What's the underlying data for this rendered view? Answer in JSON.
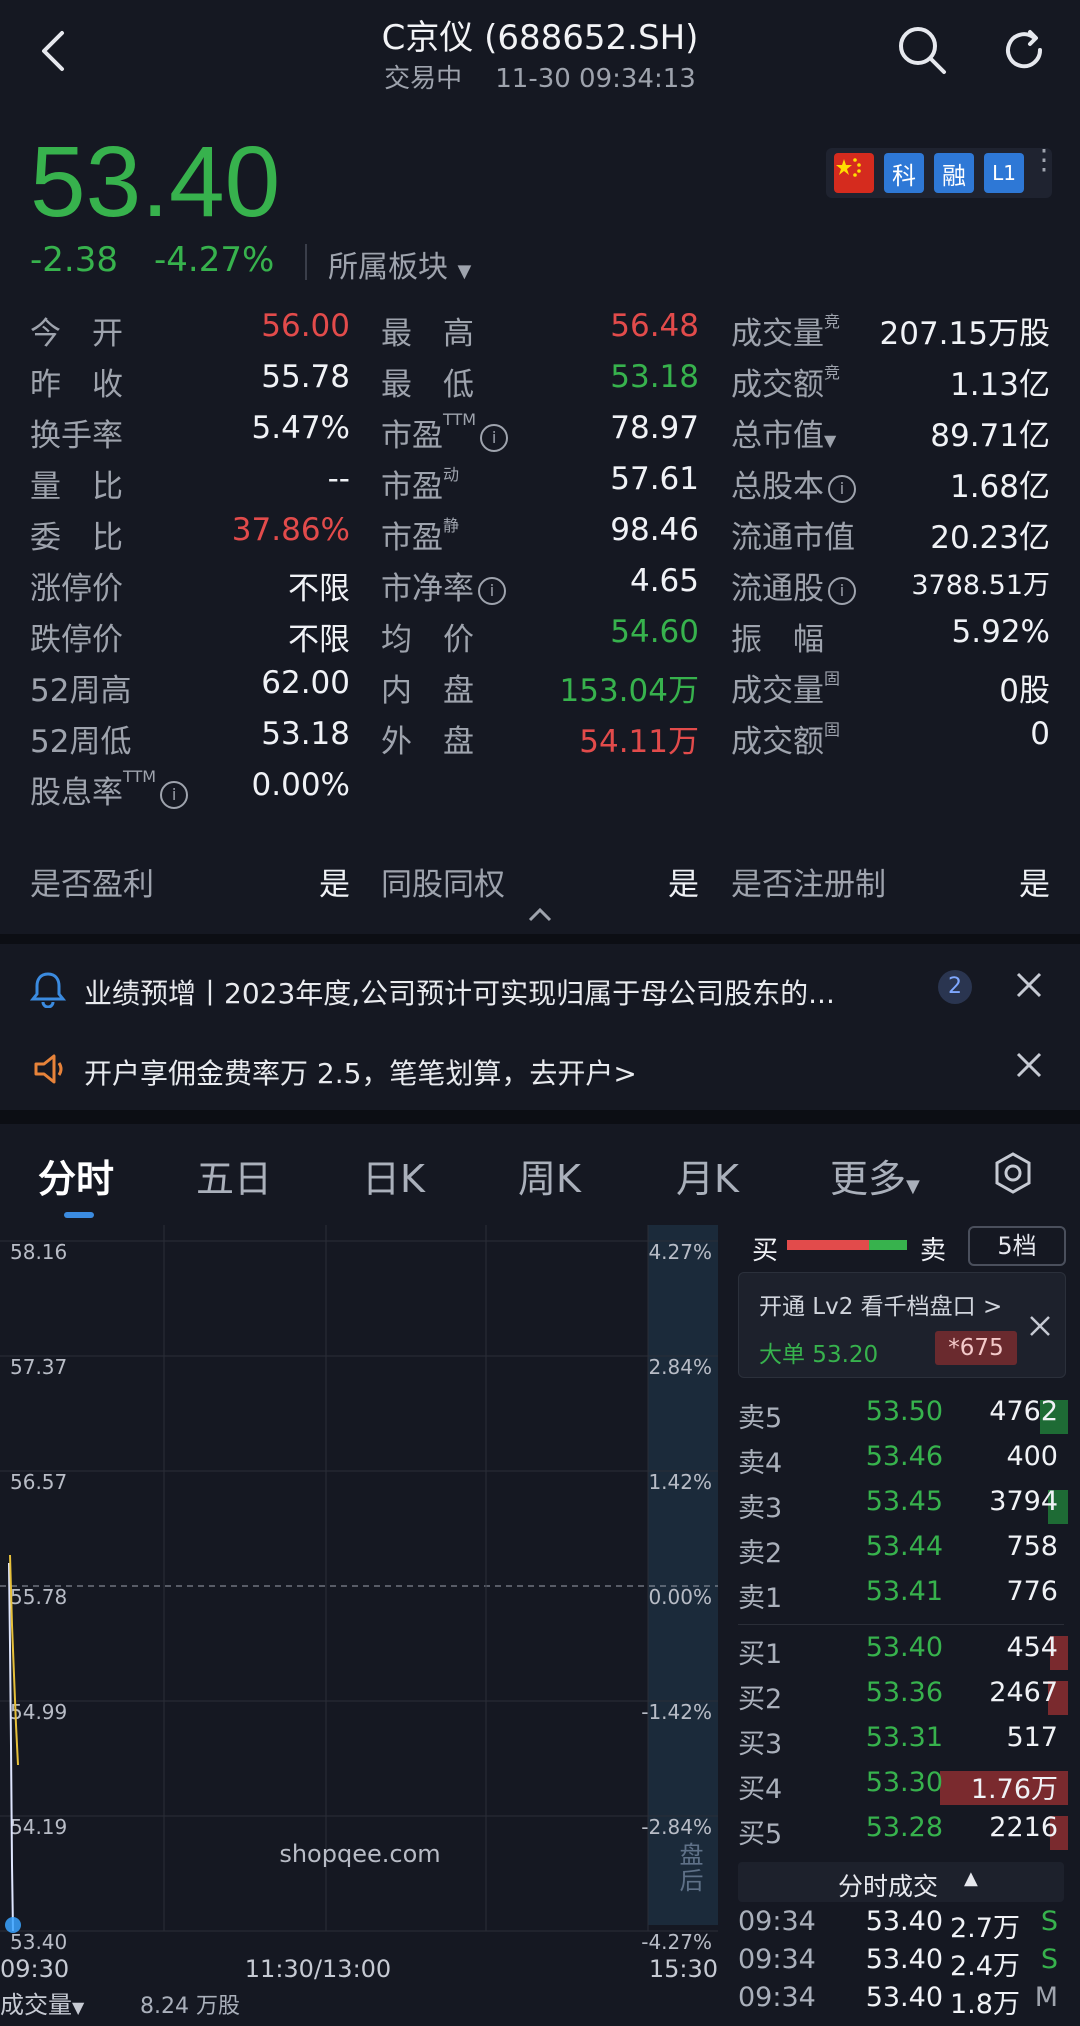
{
  "header": {
    "title": "C京仪 (688652.SH)",
    "status": "交易中",
    "datetime": "11-30 09:34:13"
  },
  "quote": {
    "price": "53.40",
    "change": "-2.38",
    "change_pct": "-4.27%",
    "sector": "所属板块",
    "badges": [
      "科",
      "融",
      "L1"
    ]
  },
  "stats": {
    "col1": [
      {
        "label": "今　开",
        "value": "56.00"
      },
      {
        "label": "昨　收",
        "value": "55.78"
      },
      {
        "label": "换手率",
        "value": "5.47%"
      },
      {
        "label": "量　比",
        "value": "--"
      },
      {
        "label": "委　比",
        "value": "37.86%"
      },
      {
        "label": "涨停价",
        "value": "不限"
      },
      {
        "label": "跌停价",
        "value": "不限"
      },
      {
        "label": "52周高",
        "value": "62.00"
      },
      {
        "label": "52周低",
        "value": "53.18"
      },
      {
        "label": "股息率",
        "sup": "TTM",
        "value": "0.00%"
      }
    ],
    "col2": [
      {
        "label": "最　高",
        "value": "56.48"
      },
      {
        "label": "最　低",
        "value": "53.18"
      },
      {
        "label": "市盈",
        "sup": "TTM",
        "value": "78.97"
      },
      {
        "label": "市盈",
        "sup": "动",
        "value": "57.61"
      },
      {
        "label": "市盈",
        "sup": "静",
        "value": "98.46"
      },
      {
        "label": "市净率",
        "value": "4.65"
      },
      {
        "label": "均　价",
        "value": "54.60"
      },
      {
        "label": "内　盘",
        "value": "153.04万"
      },
      {
        "label": "外　盘",
        "value": "54.11万"
      }
    ],
    "col3": [
      {
        "label": "成交量",
        "sup": "竞",
        "value": "207.15万股"
      },
      {
        "label": "成交额",
        "sup": "竞",
        "value": "1.13亿"
      },
      {
        "label": "总市值",
        "value": "89.71亿"
      },
      {
        "label": "总股本",
        "value": "1.68亿"
      },
      {
        "label": "流通市值",
        "value": "20.23亿"
      },
      {
        "label": "流通股",
        "value": "3788.51万"
      },
      {
        "label": "振　幅",
        "value": "5.92%"
      },
      {
        "label": "成交量",
        "sup": "固",
        "value": "0股"
      },
      {
        "label": "成交额",
        "sup": "固",
        "value": "0"
      }
    ],
    "flags": [
      {
        "label": "是否盈利",
        "value": "是"
      },
      {
        "label": "同股同权",
        "value": "是"
      },
      {
        "label": "是否注册制",
        "value": "是"
      }
    ]
  },
  "notices": {
    "earnings": "业绩预增丨2023年度,公司预计可实现归属于母公司股东的...",
    "earnings_count": "2",
    "promo": "开户享佣金费率万 2.5，笔笔划算，去开户>"
  },
  "tabs": [
    "分时",
    "五日",
    "日K",
    "周K",
    "月K",
    "更多"
  ],
  "chart": {
    "y_prices": [
      "58.16",
      "57.37",
      "56.57",
      "55.78",
      "54.99",
      "54.19",
      "53.40"
    ],
    "y_pcts": [
      "4.27%",
      "2.84%",
      "1.42%",
      "0.00%",
      "-1.42%",
      "-2.84%",
      "-4.27%"
    ],
    "x_labels": [
      "09:30",
      "11:30/13:00",
      "15:30"
    ],
    "after_hours": "盘后",
    "volume_label": "成交量",
    "volume_value": "8.24 万股"
  },
  "orderbook": {
    "buy_label": "买",
    "sell_label": "卖",
    "depth_button": "5档",
    "lv2_promo": "开通 Lv2 看千档盘口 >",
    "big_order_label": "大单 53.20",
    "big_order_value": "*675",
    "asks": [
      {
        "label": "卖5",
        "price": "53.50",
        "vol": "4762"
      },
      {
        "label": "卖4",
        "price": "53.46",
        "vol": "400"
      },
      {
        "label": "卖3",
        "price": "53.45",
        "vol": "3794"
      },
      {
        "label": "卖2",
        "price": "53.44",
        "vol": "758"
      },
      {
        "label": "卖1",
        "price": "53.41",
        "vol": "776"
      }
    ],
    "bids": [
      {
        "label": "买1",
        "price": "53.40",
        "vol": "454"
      },
      {
        "label": "买2",
        "price": "53.36",
        "vol": "2467"
      },
      {
        "label": "买3",
        "price": "53.31",
        "vol": "517"
      },
      {
        "label": "买4",
        "price": "53.30",
        "vol": "1.76万"
      },
      {
        "label": "买5",
        "price": "53.28",
        "vol": "2216"
      }
    ],
    "trades_title": "分时成交",
    "trades": [
      {
        "time": "09:34",
        "price": "53.40",
        "vol": "2.7万",
        "side": "S"
      },
      {
        "time": "09:34",
        "price": "53.40",
        "vol": "2.4万",
        "side": "S"
      },
      {
        "time": "09:34",
        "price": "53.40",
        "vol": "1.8万",
        "side": "M"
      }
    ]
  },
  "watermark": "shopqee.com"
}
